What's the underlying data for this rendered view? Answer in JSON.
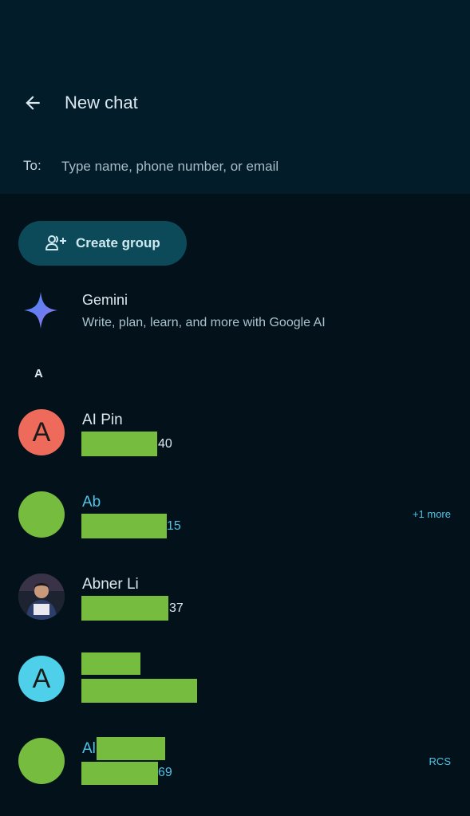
{
  "header": {
    "title": "New chat",
    "to_label": "To:",
    "to_placeholder": "Type name, phone number, or email"
  },
  "create_group": {
    "label": "Create group",
    "icon": "add-group-icon"
  },
  "gemini": {
    "name": "Gemini",
    "description": "Write, plan, learn, and more with Google AI",
    "icon": "gemini-sparkle-icon"
  },
  "section": {
    "letter": "A"
  },
  "contacts": [
    {
      "name": "AI Pin",
      "avatar_letter": "A",
      "avatar_color": "#ee6a5a",
      "number_suffix": "40"
    },
    {
      "name": "Ab",
      "avatar_letter": "",
      "avatar_color": "#76bd3f",
      "number_suffix": "15",
      "tag": "+1 more"
    },
    {
      "name": "Abner Li",
      "avatar_letter": "",
      "avatar_color": "#2a2f3a",
      "number_suffix": "37"
    },
    {
      "name": "",
      "avatar_letter": "A",
      "avatar_color": "#4fd0ea",
      "number_suffix": ""
    },
    {
      "name": "Al",
      "avatar_letter": "",
      "avatar_color": "#76bd3f",
      "number_suffix": "69",
      "tag": "RCS"
    }
  ],
  "colors": {
    "background": "#03111b",
    "header_background": "#021c2a",
    "accent": "#4fc3e6",
    "redaction": "#76bd3f"
  }
}
